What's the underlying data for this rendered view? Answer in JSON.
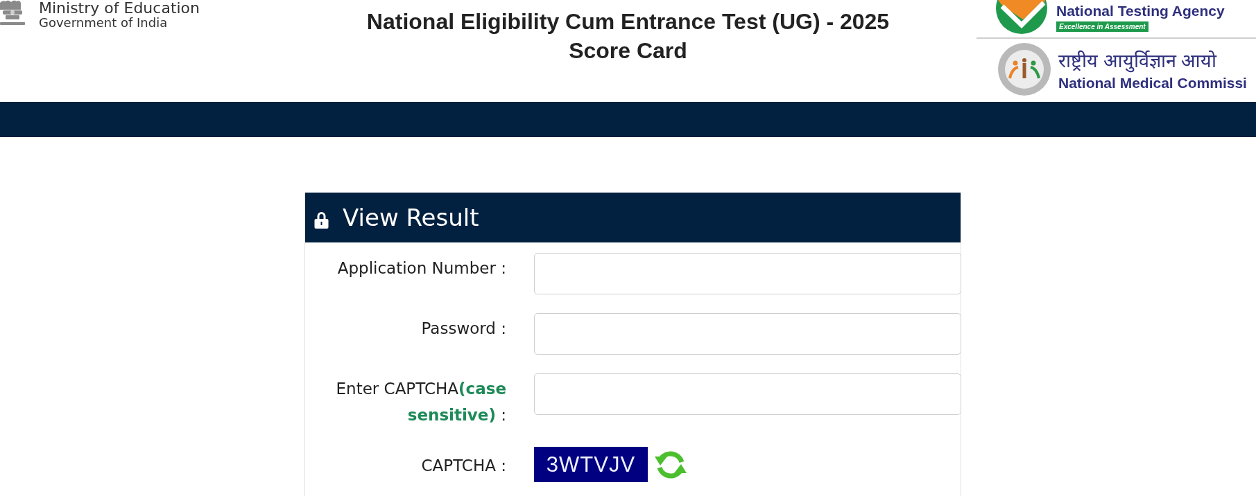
{
  "header": {
    "ministry": {
      "name": "Ministry of Education",
      "subtitle": "Government of India"
    },
    "title_lines": [
      "National Eligibility Cum Entrance Test (UG) - 2025",
      "Score Card"
    ],
    "testing_agency": {
      "name": "National Testing Agency",
      "tagline": "Excellence in Assessment"
    },
    "medical_commission": {
      "name_hindi": "राष्ट्रीय आयुर्विज्ञान आयो",
      "name": "National Medical Commissi"
    }
  },
  "form": {
    "title": "View Result",
    "fields": [
      {
        "label": "Application Number :"
      },
      {
        "label": "Password :"
      },
      {
        "label": "Enter CAPTCHA**(case sensitive)** :"
      }
    ],
    "captcha": {
      "label": "CAPTCHA :",
      "code": "3WTVJV"
    }
  }
}
